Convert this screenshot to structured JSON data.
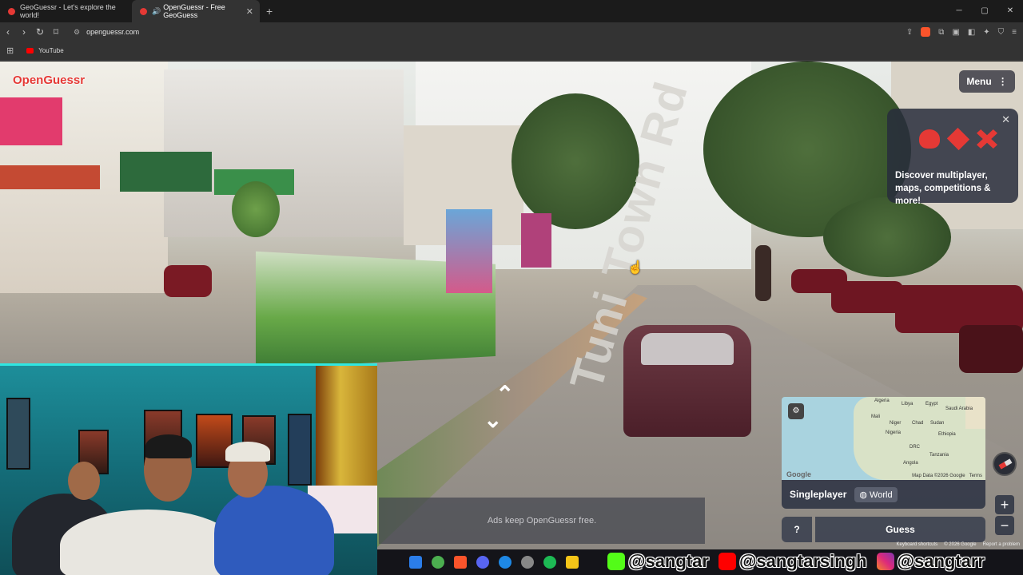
{
  "browser": {
    "tabs": [
      {
        "title": "GeoGuessr - Let's explore the world!",
        "active": false
      },
      {
        "title": "OpenGuessr - Free GeoGuess",
        "active": true
      }
    ],
    "url": "openguessr.com",
    "bookmarks": [
      {
        "label": "YouTube"
      }
    ]
  },
  "game": {
    "logo": "OpenGuessr",
    "menu_label": "Menu",
    "promo_text": "Discover multiplayer, maps, competitions & more!",
    "road_label": "Tuni Town Rd",
    "mode": "Singleplayer",
    "map_name": "World",
    "guess_label": "Guess",
    "help_label": "?",
    "ads_text": "Ads keep OpenGuessr free.",
    "map_attribution": "Map Data ©2026 Google",
    "map_terms": "Terms",
    "google_logo": "Google",
    "map_labels": [
      "Algeria",
      "Libya",
      "Egypt",
      "Saudi Arabia",
      "Mali",
      "Niger",
      "Chad",
      "Sudan",
      "Nigeria",
      "Ethiopia",
      "DRC",
      "Tanzania",
      "Angola"
    ],
    "keyboard_shortcuts": "Keyboard shortcuts",
    "map_data_footer": "© 2026 Google",
    "report_problem": "Report a problem"
  },
  "overlay": {
    "handles": [
      "@sangtar",
      "@sangtarsingh",
      "@sangtarr"
    ]
  },
  "colors": {
    "brand_red": "#e53935",
    "panel": "#32374a",
    "webcam_neon": "#2fe7e2"
  }
}
